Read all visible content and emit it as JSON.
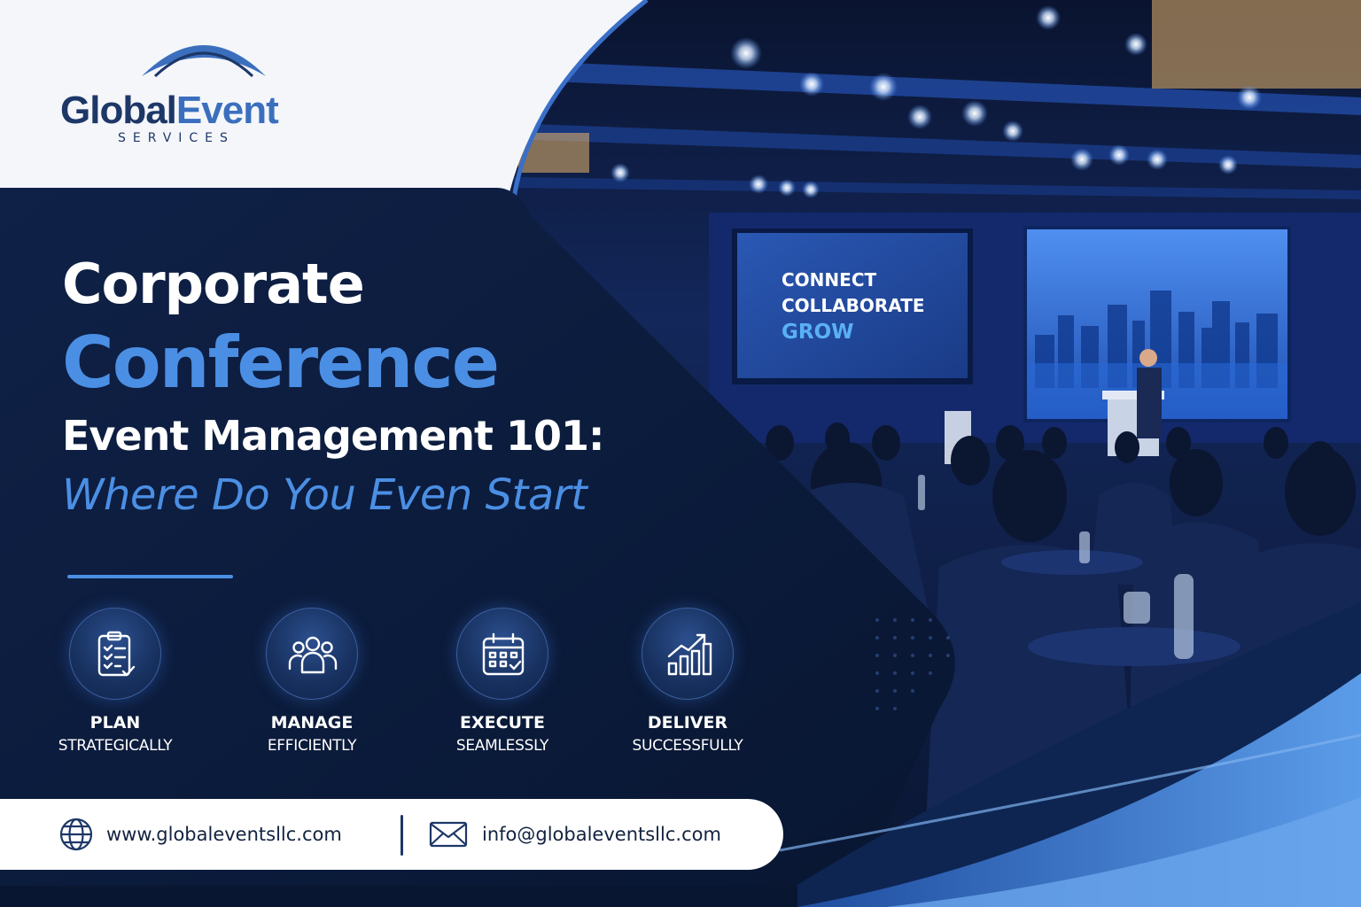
{
  "brand": {
    "name_part1": "Global",
    "name_part2": "Event",
    "tagline": "SERVICES"
  },
  "headline": {
    "line1": "Corporate",
    "line2": "Conference",
    "line3": "Event Management 101:",
    "line4": "Where Do You Even Start"
  },
  "features": [
    {
      "title": "PLAN",
      "subtitle": "STRATEGICALLY",
      "icon": "clipboard-checklist-icon"
    },
    {
      "title": "MANAGE",
      "subtitle": "EFFICIENTLY",
      "icon": "team-icon"
    },
    {
      "title": "EXECUTE",
      "subtitle": "SEAMLESSLY",
      "icon": "calendar-icon"
    },
    {
      "title": "DELIVER",
      "subtitle": "SUCCESSFULLY",
      "icon": "growth-chart-icon"
    }
  ],
  "contact": {
    "website": "www.globaleventsllc.com",
    "email": "info@globaleventsllc.com"
  },
  "stage_screen": {
    "line1": "CONNECT",
    "line2": "COLLABORATE",
    "line3": "GROW"
  },
  "colors": {
    "navy": "#0b1a36",
    "accent_blue": "#4b8fe4",
    "logo_navy": "#1d3767",
    "white": "#ffffff"
  }
}
